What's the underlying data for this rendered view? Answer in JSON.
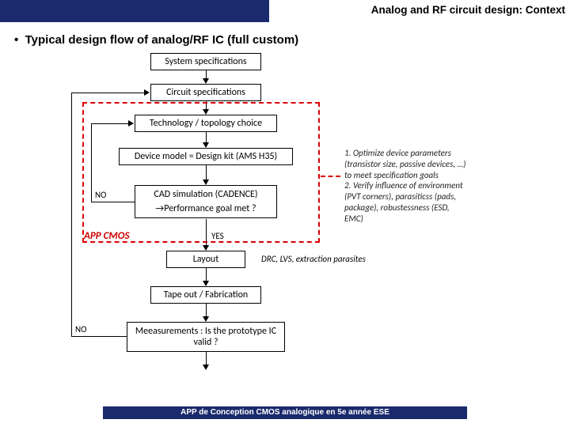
{
  "header": {
    "title": "Analog and RF circuit design: Context"
  },
  "bullet": "Typical design flow of analog/RF IC (full custom)",
  "boxes": {
    "b1": "System specifications",
    "b2": "Circuit specifications",
    "b3": "Technology / topology choice",
    "b4": "Device model = Design kit (AMS H35)",
    "b5a": "CAD simulation (CADENCE)",
    "b5b": "→Performance goal met ?",
    "b6": "Layout",
    "b7": "Tape out / Fabrication",
    "b8": "Meeasurements : Is the prototype IC valid ?"
  },
  "labels": {
    "no1": "NO",
    "yes1": "YES",
    "no2": "NO",
    "drc": "DRC, LVS, extraction parasites"
  },
  "side_note": {
    "l1": "1. Optimize device parameters",
    "l2": "(transistor size, passive devices, …)",
    "l3": "to meet specification goals",
    "l4": "2. Verify influence of environment",
    "l5": "(PVT corners), parasiticss (pads,",
    "l6": "package), robustessness (ESD,",
    "l7": "EMC)"
  },
  "app_cmos": "APP CMOS",
  "footer": "APP de Conception CMOS analogique en 5e année ESE"
}
